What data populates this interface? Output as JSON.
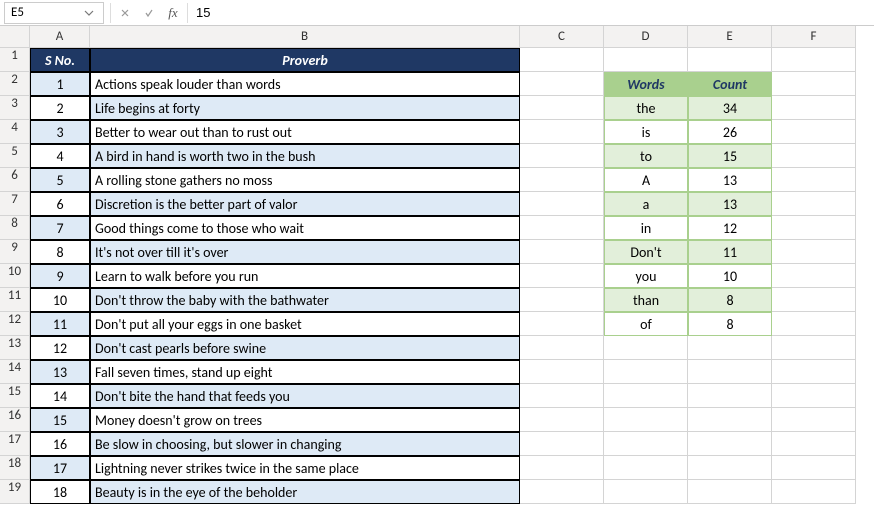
{
  "nameBox": "E5",
  "formulaValue": "15",
  "columns": [
    "A",
    "B",
    "C",
    "D",
    "E",
    "F"
  ],
  "rowCount": 19,
  "mainHeader": {
    "sno": "S No.",
    "proverb": "Proverb"
  },
  "proverbs": [
    {
      "n": "1",
      "t": "Actions speak louder than words"
    },
    {
      "n": "2",
      "t": "Life begins at forty"
    },
    {
      "n": "3",
      "t": "Better to wear out than to rust out"
    },
    {
      "n": "4",
      "t": "A bird in hand is worth two in the bush"
    },
    {
      "n": "5",
      "t": "A rolling stone gathers no moss"
    },
    {
      "n": "6",
      "t": "Discretion is the better part of valor"
    },
    {
      "n": "7",
      "t": "Good things come to those who wait"
    },
    {
      "n": "8",
      "t": "It's not over till it's over"
    },
    {
      "n": "9",
      "t": "Learn to walk before you run"
    },
    {
      "n": "10",
      "t": "Don't throw the baby with the bathwater"
    },
    {
      "n": "11",
      "t": "Don't put all your eggs in one basket"
    },
    {
      "n": "12",
      "t": "Don't cast pearls before swine"
    },
    {
      "n": "13",
      "t": "Fall seven times, stand up eight"
    },
    {
      "n": "14",
      "t": "Don't bite the hand that feeds you"
    },
    {
      "n": "15",
      "t": "Money doesn't grow on trees"
    },
    {
      "n": "16",
      "t": "Be slow in choosing, but slower in changing"
    },
    {
      "n": "17",
      "t": "Lightning never strikes twice in the same place"
    },
    {
      "n": "18",
      "t": "Beauty is in the eye of the beholder"
    }
  ],
  "miniHeader": {
    "words": "Words",
    "count": "Count"
  },
  "mini": [
    {
      "w": "the",
      "c": "34"
    },
    {
      "w": "is",
      "c": "26"
    },
    {
      "w": "to",
      "c": "15"
    },
    {
      "w": "A",
      "c": "13"
    },
    {
      "w": "a",
      "c": "13"
    },
    {
      "w": "in",
      "c": "12"
    },
    {
      "w": "Don't",
      "c": "11"
    },
    {
      "w": "you",
      "c": "10"
    },
    {
      "w": "than",
      "c": "8"
    },
    {
      "w": "of",
      "c": "8"
    }
  ]
}
